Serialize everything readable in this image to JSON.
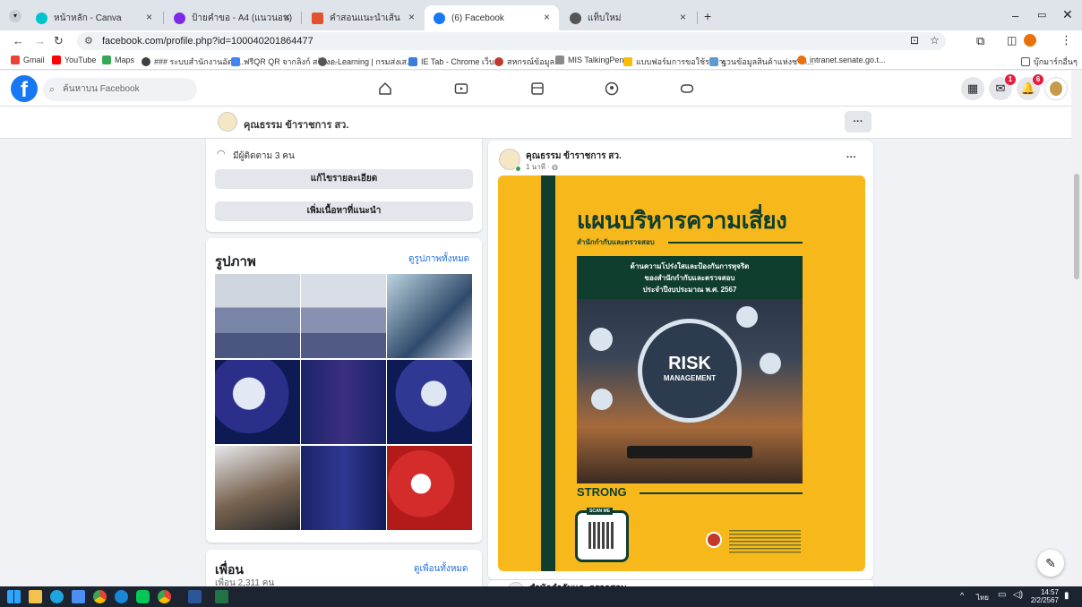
{
  "browser": {
    "tabs": [
      {
        "title": "หน้าหลัก - Canva",
        "color": "#00c4cc"
      },
      {
        "title": "ป้ายคำขอ - A4 (แนวนอน)",
        "color": "#7d2ae8"
      },
      {
        "title": "คำสอนแนะนำเส้น",
        "color": "#e0532e"
      },
      {
        "title": "(6) Facebook",
        "color": "#1877f2"
      },
      {
        "title": "แท็บใหม่",
        "color": "#555555"
      }
    ],
    "new_tab": "+",
    "url": "facebook.com/profile.php?id=100040201864477",
    "bookmarks": [
      {
        "label": "Gmail",
        "color": "#ea4335"
      },
      {
        "label": "YouTube",
        "color": "#ff0000"
      },
      {
        "label": "Maps",
        "color": "#34a853"
      },
      {
        "label": "### ระบบสำนักงานอัตโ...",
        "color": "#3c4043"
      },
      {
        "label": "ฟรีQR QR จากลิงก์ สร้าง...",
        "color": "#4285f4"
      },
      {
        "label": "e-Learning | กรมส่งเส...",
        "color": "#555555"
      },
      {
        "label": "IE Tab - Chrome เว็บ...",
        "color": "#3b7ddd"
      },
      {
        "label": "สหกรณ์ข้อมูลกา",
        "color": "#c0392b"
      },
      {
        "label": "MIS TalkingPen",
        "color": "#8a8a8a"
      },
      {
        "label": "แบบฟอร์มการขอใช้รถรา...",
        "color": "#fbbc04"
      },
      {
        "label": "ฐานข้อมูลสินค้าแห่งชาติ...",
        "color": "#5a9bd5"
      },
      {
        "label": "intranet.senate.go.t...",
        "color": "#e8710a"
      }
    ],
    "bookmarks_folder": "บุ๊กมาร์กอื่นๆ"
  },
  "facebook": {
    "search_placeholder": "ค้นหาบน Facebook",
    "messenger_badge": "1",
    "notif_badge": "6",
    "profile_name": "คุณธรรม ข้าราชการ สว.",
    "more": "···",
    "intro": {
      "followers": "มีผู้ติดตาม 3 คน",
      "edit_details": "แก้ไขรายละเอียด",
      "add_featured": "เพิ่มเนื้อหาที่แนะนำ"
    },
    "photos": {
      "title": "รูปภาพ",
      "see_all": "ดูรูปภาพทั้งหมด"
    },
    "friends": {
      "title": "เพื่อน",
      "count": "เพื่อน 2,311 คน",
      "see_all": "ดูเพื่อนทั้งหมด"
    },
    "post": {
      "author": "คุณธรรม ข้าราชการ สว.",
      "time": "1 นาที · ",
      "next_author": "สำนักกำกับและตรวจสอบ"
    },
    "poster": {
      "title": "แผนบริหารความเสี่ยง",
      "subtitle": "สำนักกำกับและตรวจสอบ",
      "box_line1": "ด้านความโปร่งใสและป้องกันการทุจริต",
      "box_line2": "ของสำนักกำกับและตรวจสอบ",
      "box_line3": "ประจำปีงบประมาณ พ.ศ. 2567",
      "risk_line1": "RISK",
      "risk_line2": "MANAGEMENT",
      "strong": "STRONG",
      "scan": "SCAN ME"
    }
  },
  "taskbar": {
    "lang": "ไทย",
    "time": "14:57",
    "date": "2/2/2567"
  }
}
